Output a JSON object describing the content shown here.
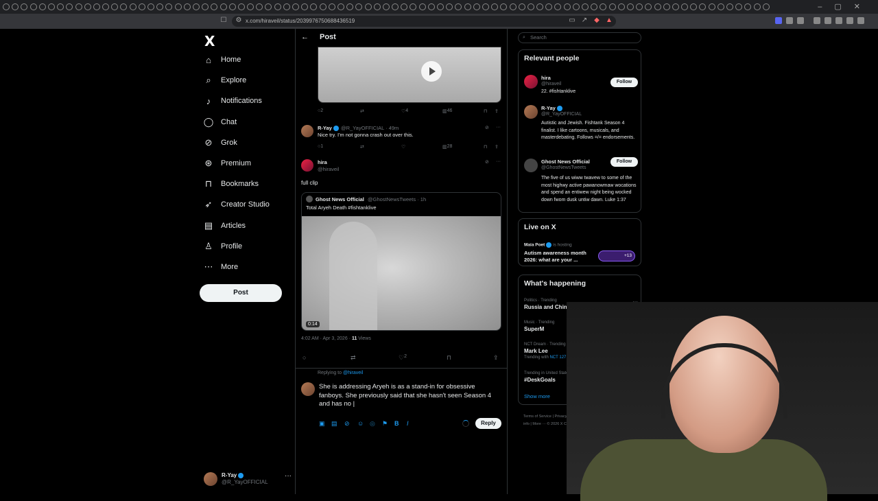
{
  "browser": {
    "url": "x.com/hiraveil/status/2039976750688436519"
  },
  "nav": {
    "logo": "X",
    "items": [
      {
        "label": "Home",
        "icon": "home-icon"
      },
      {
        "label": "Explore",
        "icon": "search-icon"
      },
      {
        "label": "Notifications",
        "icon": "bell-icon"
      },
      {
        "label": "Chat",
        "icon": "chat-icon"
      },
      {
        "label": "Grok",
        "icon": "grok-icon"
      },
      {
        "label": "Premium",
        "icon": "premium-icon"
      },
      {
        "label": "Bookmarks",
        "icon": "bookmark-icon"
      },
      {
        "label": "Creator Studio",
        "icon": "rocket-icon"
      },
      {
        "label": "Articles",
        "icon": "article-icon"
      },
      {
        "label": "Profile",
        "icon": "person-icon"
      },
      {
        "label": "More",
        "icon": "more-icon"
      }
    ],
    "post_button": "Post",
    "account": {
      "name": "R-Yay",
      "handle": "@R_YayOFFICIAL"
    }
  },
  "main": {
    "header_title": "Post",
    "top_video_stats": {
      "replies": "2",
      "likes": "4",
      "views": "46"
    },
    "reply1": {
      "name": "R-Yay",
      "handle": "@R_YayOFFICIAL · 49m",
      "text": "Nice try. I'm not gonna crash out over this.",
      "stats": {
        "replies": "1",
        "views": "28"
      }
    },
    "reply2": {
      "name": "hira",
      "handle": "@hiraveil",
      "text": "full clip"
    },
    "quote": {
      "name": "Ghost News Official",
      "handle": "@GhostNewsTweets · 1h",
      "text": "Total Aryeh Death #fishtanklive",
      "duration": "0:14"
    },
    "meta_time": "4:02 AM · Apr 3, 2026 · ",
    "meta_views_count": "11",
    "meta_views_label": " Views",
    "main_likes": "2",
    "compose": {
      "replying_prefix": "Replying to ",
      "replying_handle": "@hiraveil",
      "text": "She is addressing Aryeh is as a stand-in for obsessive fanboys. She previously said that she hasn't seen Season 4 and has no |",
      "reply_button": "Reply"
    }
  },
  "sidebar": {
    "search_placeholder": "Search",
    "relevant_title": "Relevant people",
    "people": [
      {
        "name": "hira",
        "handle": "@hiraveil",
        "bio": "22. #fishtanklive",
        "follow": "Follow"
      },
      {
        "name": "R-Yay",
        "handle": "@R_YayOFFICIAL",
        "bio": "Autistic and Jewish. Fishtank Season 4 finalist. I like cartoons, musicals, and masterdebating. Follows =/= endorsements."
      },
      {
        "name": "Ghost News Official",
        "handle": "@GhostNewsTweets",
        "bio": "The five of us wiww twavew to some of the most highwy active pawanowmaw wocations and spend an entiwew night being wocked down fwom dusk untiw dawn. Luke 1:37",
        "follow": "Follow"
      }
    ],
    "live_title": "Live on X",
    "live": {
      "host": "Maia Poet",
      "status": "is hosting",
      "title": "Autism awareness month 2026: what are your ...",
      "count": "+13"
    },
    "happening_title": "What's happening",
    "trends": [
      {
        "meta": "Politics · Trending",
        "name": "Russia and China",
        "sub": ""
      },
      {
        "meta": "Music · Trending",
        "name": "SuperM",
        "sub": ""
      },
      {
        "meta": "NCT Dream · Trending",
        "name": "Mark Lee",
        "sub_prefix": "Trending with ",
        "sub": "NCT 127, #Unfold"
      },
      {
        "meta": "Trending in United States",
        "name": "#DeskGoals",
        "sub": ""
      }
    ],
    "show_more": "Show more",
    "footer": "Terms of Service | Privacy Policy | Cookie Policy | Accessibility | Ads info | More ··· © 2026 X Corp."
  }
}
